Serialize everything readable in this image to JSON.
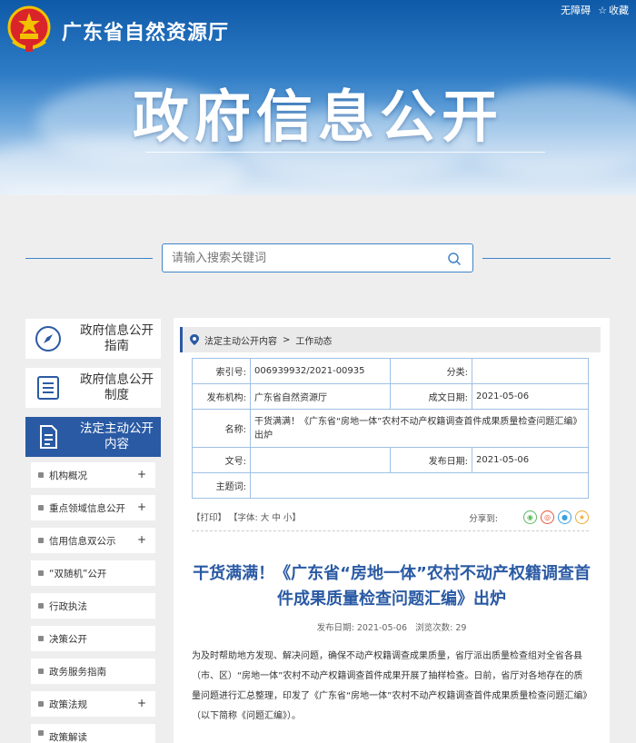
{
  "header": {
    "site_title": "广东省自然资源厅",
    "banner_title": "政府信息公开",
    "top_links": {
      "accessibility": "无障碍",
      "favorite": "收藏"
    }
  },
  "search": {
    "placeholder": "请输入搜索关键词"
  },
  "sidebar": {
    "cards": [
      {
        "label": "政府信息公开指南",
        "icon": "compass-icon"
      },
      {
        "label": "政府信息公开制度",
        "icon": "list-icon"
      },
      {
        "label": "法定主动公开内容",
        "icon": "document-icon",
        "active": true
      }
    ],
    "menu": [
      {
        "label": "机构概况",
        "expandable": true
      },
      {
        "label": "重点领域信息公开",
        "expandable": true
      },
      {
        "label": "信用信息双公示",
        "expandable": true
      },
      {
        "label": "“双随机”公开",
        "expandable": false
      },
      {
        "label": "行政执法",
        "expandable": false
      },
      {
        "label": "决策公开",
        "expandable": false
      },
      {
        "label": "政务服务指南",
        "expandable": false
      },
      {
        "label": "政策法规",
        "expandable": true
      },
      {
        "label": "政策解读",
        "expandable": false
      }
    ],
    "plus": "+"
  },
  "breadcrumb": {
    "level1": "法定主动公开内容",
    "sep": ">",
    "level2": "工作动态"
  },
  "info": {
    "index_label": "索引号:",
    "index_value": "006939932/2021-00935",
    "category_label": "分类:",
    "category_value": "",
    "org_label": "发布机构:",
    "org_value": "广东省自然资源厅",
    "created_label": "成文日期:",
    "created_value": "2021-05-06",
    "name_label": "名称:",
    "name_value": "干货满满！《广东省“房地一体”农村不动产权籍调查首件成果质量检查问题汇编》出炉",
    "docno_label": "文号:",
    "docno_value": "",
    "published_label": "发布日期:",
    "published_value": "2021-05-06",
    "subject_label": "主题词:",
    "subject_value": ""
  },
  "tools": {
    "print": "【打印】",
    "font_open": "【字体:",
    "font_large": "大",
    "font_medium": "中",
    "font_small": "小",
    "font_close": "】",
    "share_label": "分享到:"
  },
  "article": {
    "title": "干货满满！《广东省“房地一体”农村不动产权籍调查首件成果质量检查问题汇编》出炉",
    "date_label": "发布日期:",
    "date_value": "2021-05-06",
    "views_label": "浏览次数:",
    "views_value": "29",
    "body": "为及时帮助地方发现、解决问题，确保不动产权籍调查成果质量，省厅派出质量检查组对全省各县（市、区）“房地一体”农村不动产权籍调查首件成果开展了抽样检查。日前，省厅对各地存在的质量问题进行汇总整理，印发了《广东省“房地一体”农村不动产权籍调查首件成果质量检查问题汇编》（以下简称《问题汇编》）。"
  },
  "colors": {
    "primary": "#2a5aa4",
    "accent_line": "#3f84c8",
    "table_border": "#9ec1e4",
    "title_blue": "#2a5aa4"
  }
}
